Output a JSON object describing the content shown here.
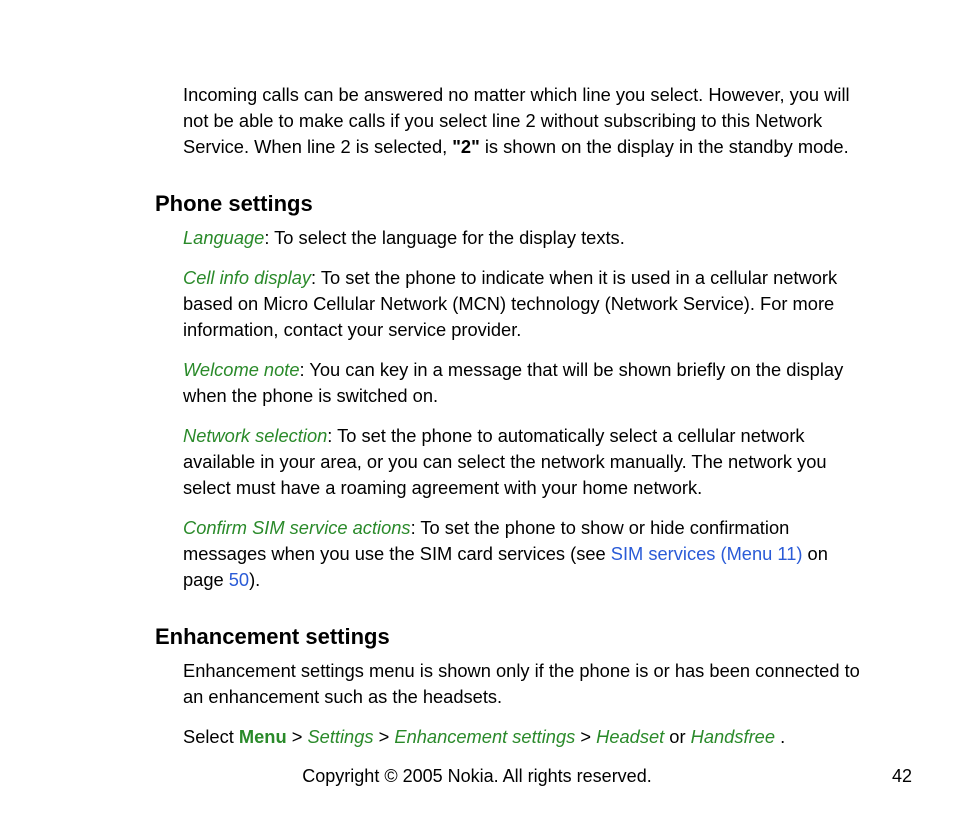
{
  "intro": {
    "part1": "Incoming calls can be answered no matter which line you select. However, you will not be able to make calls if you select line 2 without subscribing to this Network Service. When line 2 is selected, ",
    "bold": "\"2\"",
    "part2": " is shown on the display in the standby mode."
  },
  "phone_settings": {
    "heading": "Phone settings",
    "items": [
      {
        "term": "Language",
        "text": ": To select the language for the display texts."
      },
      {
        "term": "Cell info display",
        "text": ": To set the phone to indicate when it is used in a cellular network based on Micro Cellular Network (MCN) technology (Network Service). For more information, contact your service provider."
      },
      {
        "term": "Welcome note",
        "text": ": You can key in a message that will be shown briefly on the display when the phone is switched on."
      },
      {
        "term": "Network selection",
        "text": ": To set the phone to automatically select a cellular network available in your area, or you can select the network manually. The network you select must have a roaming agreement with your home network."
      }
    ],
    "confirm": {
      "term": "Confirm SIM service actions",
      "text1": ": To set the phone to show or hide confirmation messages when you use the SIM card services (see ",
      "link1": "SIM services (Menu 11)",
      "text2": " on page ",
      "link2": "50",
      "text3": ")."
    }
  },
  "enhancement": {
    "heading": "Enhancement settings",
    "intro": "Enhancement settings menu is shown only if the phone is or has been connected to an enhancement such as the headsets.",
    "nav": {
      "prefix": "Select ",
      "menu": "Menu",
      "sep": " > ",
      "settings": "Settings",
      "enh": "Enhancement settings",
      "headset": "Headset",
      "or": " or ",
      "handsfree": "Handsfree ",
      "suffix": "."
    }
  },
  "footer": "Copyright © 2005 Nokia. All rights reserved.",
  "page_number": "42"
}
